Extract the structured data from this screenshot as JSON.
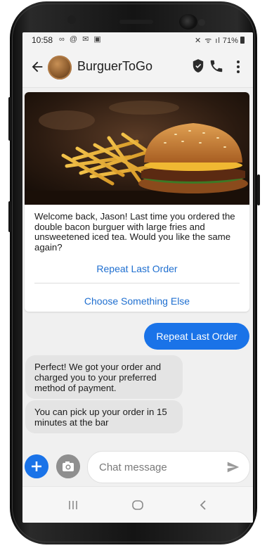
{
  "status": {
    "time": "10:58",
    "left_icons": "∞ @ ✉ ▣",
    "right": "71%"
  },
  "header": {
    "title": "BurguerToGo"
  },
  "card": {
    "message": "Welcome back, Jason! Last time you ordered the double bacon burguer with large fries and unsweetened iced tea. Would you like the same again?",
    "actions": [
      "Repeat Last Order",
      "Choose Something Else"
    ]
  },
  "messages": [
    {
      "from": "user",
      "text": "Repeat Last Order"
    },
    {
      "from": "bot",
      "text": "Perfect! We got your order and charged you to your preferred method of payment."
    },
    {
      "from": "bot",
      "text": "You can pick up your order in 15 minutes at the bar"
    }
  ],
  "composer": {
    "placeholder": "Chat message"
  },
  "colors": {
    "accent": "#1a73e8",
    "bot_bubble": "#e4e4e4",
    "link": "#1f6fd0"
  },
  "icons": [
    "back-arrow-icon",
    "shield-icon",
    "phone-icon",
    "more-vert-icon",
    "add-icon",
    "camera-icon",
    "send-icon",
    "recents-nav-icon",
    "home-nav-icon",
    "back-nav-icon"
  ]
}
